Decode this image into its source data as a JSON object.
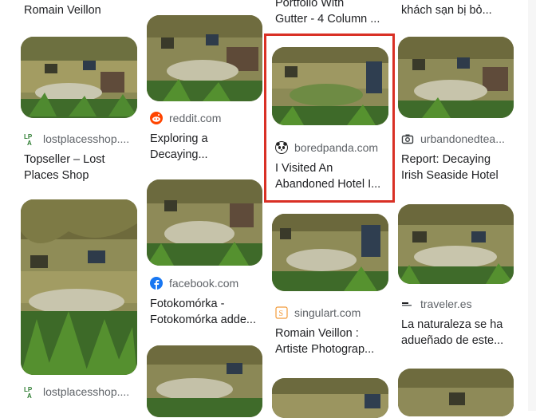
{
  "results": [
    {
      "source": "",
      "title_lines": [
        "Romain Veillon"
      ]
    },
    {
      "source": "lostplacesshop....",
      "favicon": "lp-icon",
      "title_lines": [
        "Topseller – Lost",
        "Places Shop"
      ]
    },
    {
      "source": "lostplacesshop....",
      "favicon": "lp-icon",
      "title_lines": []
    },
    {
      "source": "reddit.com",
      "favicon": "reddit-icon",
      "title_lines": [
        "Exploring a",
        "Decaying..."
      ]
    },
    {
      "source": "facebook.com",
      "favicon": "facebook-icon",
      "title_lines": [
        "Fotokomórka -",
        "Fotokomórka adde..."
      ]
    },
    {
      "source": "",
      "title_lines": [
        "Portfolio With",
        "Gutter - 4 Column ..."
      ]
    },
    {
      "source": "boredpanda.com",
      "favicon": "panda-icon",
      "title_lines": [
        "I Visited An",
        "Abandoned Hotel I..."
      ],
      "selected": true
    },
    {
      "source": "singulart.com",
      "favicon": "singulart-icon",
      "title_lines": [
        "Romain Veillon :",
        "Artiste Photograp..."
      ]
    },
    {
      "source": "",
      "title_lines": [
        "khách sạn bị bỏ..."
      ]
    },
    {
      "source": "urbandonedtea...",
      "favicon": "camera-icon",
      "title_lines": [
        "Report: Decaying",
        "Irish Seaside Hotel"
      ]
    },
    {
      "source": "traveler.es",
      "favicon": "traveler-icon",
      "title_lines": [
        "La naturaleza se ha",
        "adueñado de este..."
      ]
    }
  ],
  "colors": {
    "selection_border": "#d93025",
    "reddit": "#ff4500",
    "facebook": "#1877f2",
    "lp_green": "#2e7d32",
    "singulart": "#f29b3a"
  }
}
